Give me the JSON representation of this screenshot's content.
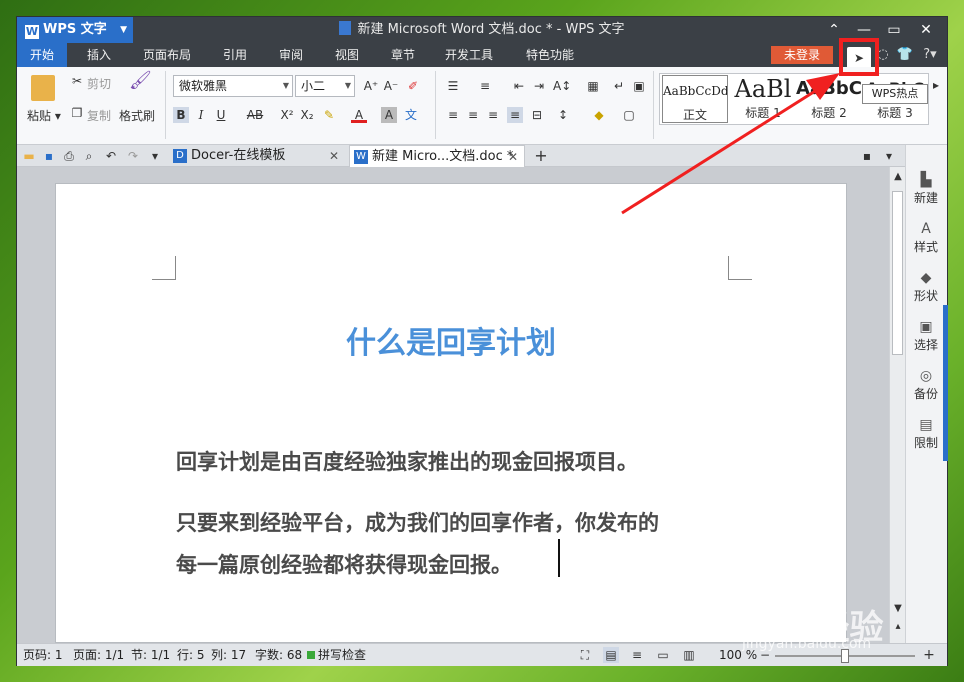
{
  "app": {
    "name": "WPS 文字",
    "window_title": "新建 Microsoft Word 文档.doc * - WPS 文字"
  },
  "menu": [
    {
      "label": "开始",
      "active": true
    },
    {
      "label": "插入"
    },
    {
      "label": "页面布局"
    },
    {
      "label": "引用"
    },
    {
      "label": "审阅"
    },
    {
      "label": "视图"
    },
    {
      "label": "章节"
    },
    {
      "label": "开发工具"
    },
    {
      "label": "特色功能"
    }
  ],
  "login_label": "未登录",
  "hot_tooltip": "WPS热点",
  "ribbon": {
    "paste": "粘贴",
    "cut": "剪切",
    "copy": "复制",
    "format_painter": "格式刷",
    "font_name": "微软雅黑",
    "font_size": "小二",
    "styles": [
      {
        "preview": "AaBbCcDd",
        "name": "正文"
      },
      {
        "preview": "AaBl",
        "name": "标题 1"
      },
      {
        "preview": "AaBbC",
        "name": "标题 2"
      },
      {
        "preview": "AaBbC",
        "name": "标题 3"
      }
    ]
  },
  "tabs": [
    {
      "label": "Docer-在线模板"
    },
    {
      "label": "新建 Micro...文档.doc *",
      "active": true
    }
  ],
  "document": {
    "title": "什么是回享计划",
    "para1": "回享计划是由百度经验独家推出的现金回报项目。",
    "para2_line1": "只要来到经验平台，成为我们的回享作者，你发布的",
    "para2_line2": "每一篇原创经验都将获得现金回报。"
  },
  "side_panel": [
    {
      "label": "新建",
      "icon": "new-doc-icon"
    },
    {
      "label": "样式",
      "icon": "style-icon"
    },
    {
      "label": "形状",
      "icon": "shape-icon"
    },
    {
      "label": "选择",
      "icon": "select-icon"
    },
    {
      "label": "备份",
      "icon": "backup-icon"
    },
    {
      "label": "限制",
      "icon": "restrict-icon"
    }
  ],
  "status": {
    "page_code": "页码: 1",
    "page": "页面: 1/1",
    "section": "节: 1/1",
    "row": "行: 5",
    "col": "列: 17",
    "word_count": "字数: 68",
    "spellcheck": "拼写检查",
    "zoom": "100 %"
  },
  "watermark": {
    "main": "Bai 经验",
    "url": "jingyan.baidu.com"
  },
  "colors": {
    "accent": "#2a6fc9",
    "title_text": "#4a90d9",
    "login_button": "#e05a36",
    "highlight_box": "#f02020"
  }
}
